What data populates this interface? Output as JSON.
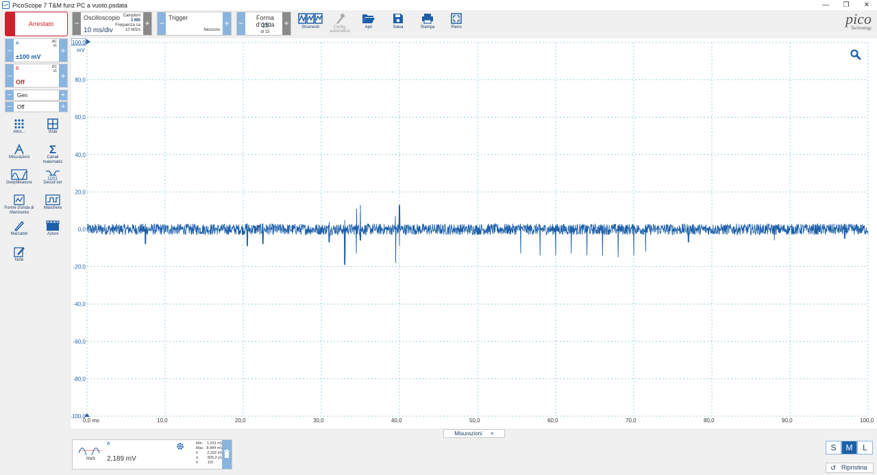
{
  "window": {
    "title": "PicoScope 7 T&M funz PC a vuoto.psdata"
  },
  "toolbar": {
    "stop_label": "Arrestato",
    "scope_mode": "Oscilloscopio",
    "timebase": "10 ms/div",
    "samples_label": "Campioni",
    "samples_value": "1 MS",
    "rate_label": "Frequenza ca",
    "rate_value": "10 MS/s",
    "trigger_label": "Trigger",
    "trigger_value": "Nessuno",
    "waveform_label": "Forma d'onda",
    "waveform_value": "15",
    "waveform_of": "di 15",
    "buttons": [
      {
        "label": "Strumenti",
        "icon": "instruments-icon",
        "enabled": true
      },
      {
        "label": "Config. automatica",
        "icon": "auto-setup-icon",
        "enabled": false
      },
      {
        "label": "Apri",
        "icon": "folder-open-icon",
        "enabled": true
      },
      {
        "label": "Salva",
        "icon": "save-icon",
        "enabled": true
      },
      {
        "label": "Stampa",
        "icon": "print-icon",
        "enabled": true
      },
      {
        "label": "Pieno",
        "icon": "fullscreen-icon",
        "enabled": true
      }
    ],
    "logo_text": "pico",
    "logo_sub": "Technology"
  },
  "channels": {
    "a": {
      "name": "A",
      "coupling": "AC",
      "probe": "x1",
      "range": "±100 mV",
      "color": "#1d5fa8"
    },
    "b": {
      "name": "B",
      "coupling": "DC",
      "probe": "x1",
      "range": "Off",
      "color": "#d0202c"
    },
    "gen": {
      "name": "Gen",
      "state": "Off"
    }
  },
  "tools": [
    {
      "label": "Altro...",
      "icon": "more-icon"
    },
    {
      "label": "Viste",
      "icon": "views-icon"
    },
    {
      "label": "Misurazioni",
      "icon": "measurements-icon"
    },
    {
      "label": "Canali matematici",
      "icon": "math-channels-icon"
    },
    {
      "label": "DeepMeasure",
      "icon": "deepmeasure-icon"
    },
    {
      "label": "Decod ser",
      "icon": "serial-decode-icon"
    },
    {
      "label": "Forme d'onda di riferimento",
      "icon": "reference-waveforms-icon"
    },
    {
      "label": "Maschere",
      "icon": "masks-icon"
    },
    {
      "label": "Marcatori",
      "icon": "rulers-icon"
    },
    {
      "label": "Azioni",
      "icon": "actions-icon"
    },
    {
      "label": "Note",
      "icon": "notes-icon"
    }
  ],
  "chart_data": {
    "type": "line",
    "x_unit": "ms",
    "y_unit": "mV",
    "xlim": [
      0,
      100
    ],
    "ylim": [
      -100,
      100
    ],
    "x_ticks": [
      "0,0 ms",
      "10,0",
      "20,0",
      "30,0",
      "40,0",
      "50,0",
      "60,0",
      "70,0",
      "80,0",
      "90,0",
      "100,0"
    ],
    "y_ticks": [
      "100,0",
      "80,0",
      "60,0",
      "40,0",
      "20,0",
      "0,0",
      "-20,0",
      "-40,0",
      "-60,0",
      "-80,0",
      "-100,0"
    ],
    "grid": true,
    "series": [
      {
        "name": "A",
        "color": "#1d5fa8",
        "noise_band_mV": 3,
        "events": [
          {
            "x": 7.5,
            "min": -8,
            "max": 3
          },
          {
            "x": 20.5,
            "min": -9,
            "max": 3
          },
          {
            "x": 22.5,
            "min": -8,
            "max": 3
          },
          {
            "x": 31,
            "min": -7,
            "max": 4
          },
          {
            "x": 33,
            "min": -19,
            "max": 5
          },
          {
            "x": 34.5,
            "min": -13,
            "max": 11
          },
          {
            "x": 35,
            "min": -6,
            "max": 13
          },
          {
            "x": 39.5,
            "min": -18,
            "max": 7
          },
          {
            "x": 40,
            "min": -9,
            "max": 13
          },
          {
            "x": 55.5,
            "min": -13,
            "max": 3
          },
          {
            "x": 58,
            "min": -14,
            "max": 2
          },
          {
            "x": 60,
            "min": -14,
            "max": 2
          },
          {
            "x": 62,
            "min": -13,
            "max": 2
          },
          {
            "x": 64,
            "min": -14,
            "max": 2
          },
          {
            "x": 66,
            "min": -14,
            "max": 2
          },
          {
            "x": 68,
            "min": -15,
            "max": 2
          },
          {
            "x": 70,
            "min": -14,
            "max": 2
          },
          {
            "x": 71.5,
            "min": -12,
            "max": 2
          },
          {
            "x": 77,
            "min": -7,
            "max": 2
          },
          {
            "x": 88,
            "min": -6,
            "max": 2
          },
          {
            "x": 97,
            "min": -5,
            "max": 3
          }
        ]
      }
    ]
  },
  "measurements": {
    "tab_label": "Misurazioni",
    "channel": "A",
    "type": "RMS",
    "value": "2,189 mV",
    "stats": [
      {
        "k": "Min.",
        "v": "1,331 mV"
      },
      {
        "k": "Max.",
        "v": "8,484 mV"
      },
      {
        "k": "x̄",
        "v": "2,332 mV"
      },
      {
        "k": "σ",
        "v": "826,2 µV"
      },
      {
        "k": "n",
        "v": "110"
      }
    ]
  },
  "view_size": {
    "options": [
      "S",
      "M",
      "L"
    ],
    "selected": "M"
  },
  "reset_label": "Ripristina"
}
